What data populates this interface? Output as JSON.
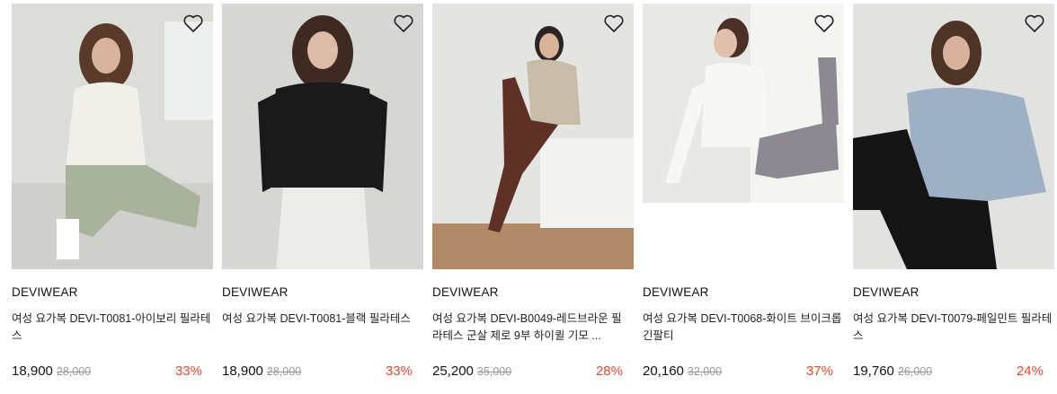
{
  "products": [
    {
      "brand": "DEVIWEAR",
      "title": "여성 요가복 DEVI-T0081-아이보리 필라테스",
      "price": "18,900",
      "original_price": "28,000",
      "discount": "33%",
      "image_alt": "model in ivory top and sage leggings sitting",
      "colors": {
        "bg": "#dcdcd8",
        "top": "#f1efe9",
        "bottom": "#a8b29c",
        "skin": "#d8b49e",
        "hair": "#5a3a28"
      }
    },
    {
      "brand": "DEVIWEAR",
      "title": "여성 요가복 DEVI-T0081-블랙 필라테스",
      "price": "18,900",
      "original_price": "28,000",
      "discount": "33%",
      "image_alt": "model in black top and white leggings",
      "colors": {
        "bg": "#d6d6d4",
        "top": "#1a1a1a",
        "bottom": "#ececea",
        "skin": "#dcbca8",
        "hair": "#3e2a20"
      }
    },
    {
      "brand": "DEVIWEAR",
      "title": "여성 요가복 DEVI-B0049-레드브라운 필라테스 군살 제로 9부 하이퀼 기모 ...",
      "price": "25,200",
      "original_price": "35,000",
      "discount": "28%",
      "image_alt": "model in beige top and red-brown leggings sitting on block",
      "colors": {
        "bg": "#e4e4e2",
        "top": "#c8bca8",
        "bottom": "#5e3026",
        "skin": "#d9b39a",
        "hair": "#2c2420"
      }
    },
    {
      "brand": "DEVIWEAR",
      "title": "여성 요가복 DEVI-T0068-화이트 브이크롭 긴팔티",
      "price": "20,160",
      "original_price": "32,000",
      "discount": "37%",
      "image_alt": "model in white wrap top and grey leggings",
      "colors": {
        "bg": "#e8e8e6",
        "top": "#f7f7f5",
        "bottom": "#8c8a90",
        "skin": "#e0c0aa",
        "hair": "#4a3026"
      }
    },
    {
      "brand": "DEVIWEAR",
      "title": "여성 요가복 DEVI-T0079-페일민트 필라테스",
      "price": "19,760",
      "original_price": "26,000",
      "discount": "24%",
      "image_alt": "model in pale blue top and black leggings",
      "colors": {
        "bg": "#e2e2e0",
        "top": "#9eb0c4",
        "bottom": "#151515",
        "skin": "#d6b29c",
        "hair": "#4e3426"
      }
    }
  ],
  "icons": {
    "wishlist": "heart-outline-icon"
  },
  "accent_discount_color": "#e8472f"
}
